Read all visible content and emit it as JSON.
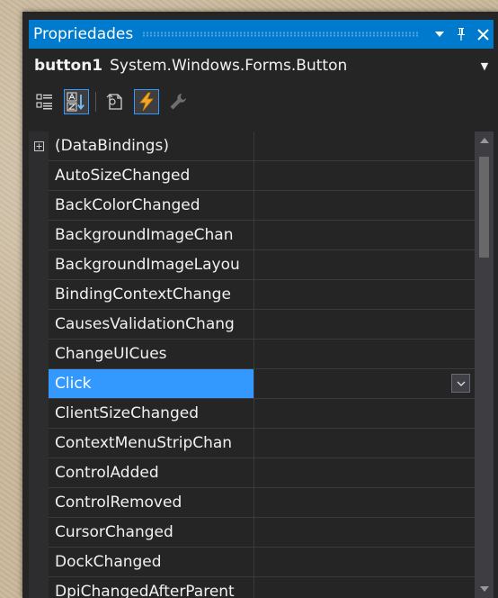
{
  "window": {
    "title": "Propriedades",
    "controls": [
      {
        "icon": "dropdown-arrow-icon",
        "glyph": "▼"
      },
      {
        "icon": "pin-icon",
        "glyph": "ᛘ"
      },
      {
        "icon": "close-icon",
        "glyph": "✕"
      }
    ]
  },
  "object_selector": {
    "name": "button1",
    "type": "System.Windows.Forms.Button"
  },
  "toolbar": {
    "buttons": [
      {
        "icon": "categorized-icon",
        "active": false
      },
      {
        "icon": "alphabetical-icon",
        "active": true
      },
      {
        "icon": "properties-icon",
        "active": false
      },
      {
        "icon": "events-icon",
        "active": true
      },
      {
        "icon": "property-pages-icon",
        "active": false,
        "disabled": true
      }
    ]
  },
  "grid": {
    "rows": [
      {
        "label": "(DataBindings)",
        "expandable": true
      },
      {
        "label": "AutoSizeChanged"
      },
      {
        "label": "BackColorChanged"
      },
      {
        "label": "BackgroundImageChan"
      },
      {
        "label": "BackgroundImageLayou"
      },
      {
        "label": "BindingContextChange"
      },
      {
        "label": "CausesValidationChang"
      },
      {
        "label": "ChangeUICues"
      },
      {
        "label": "Click",
        "selected": true
      },
      {
        "label": "ClientSizeChanged"
      },
      {
        "label": "ContextMenuStripChan"
      },
      {
        "label": "ControlAdded"
      },
      {
        "label": "ControlRemoved"
      },
      {
        "label": "CursorChanged"
      },
      {
        "label": "DockChanged"
      },
      {
        "label": "DpiChangedAfterParent"
      }
    ]
  },
  "colors": {
    "accent": "#007acc",
    "selection": "#3399ff",
    "panel_bg": "#252526",
    "text": "#f1f1f1"
  }
}
